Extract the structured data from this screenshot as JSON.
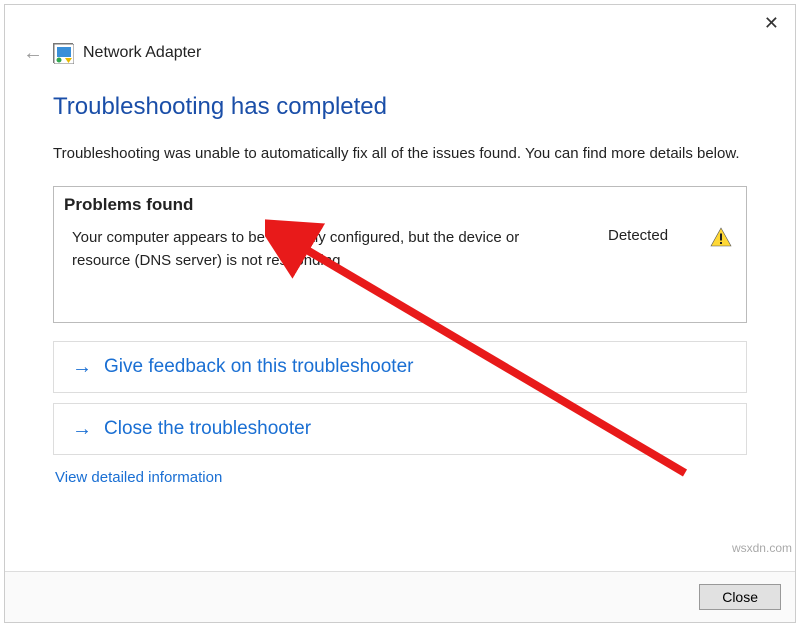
{
  "header": {
    "title": "Network Adapter"
  },
  "main": {
    "heading": "Troubleshooting has completed",
    "subtext": "Troubleshooting was unable to automatically fix all of the issues found. You can find more details below."
  },
  "problems": {
    "header": "Problems found",
    "items": [
      {
        "text": "Your computer appears to be correctly configured, but the device or resource (DNS server) is not responding",
        "status": "Detected"
      }
    ]
  },
  "actions": [
    {
      "label": "Give feedback on this troubleshooter"
    },
    {
      "label": "Close the troubleshooter"
    }
  ],
  "detailed_link": "View detailed information",
  "footer": {
    "close": "Close"
  },
  "watermark": "wsxdn.com"
}
